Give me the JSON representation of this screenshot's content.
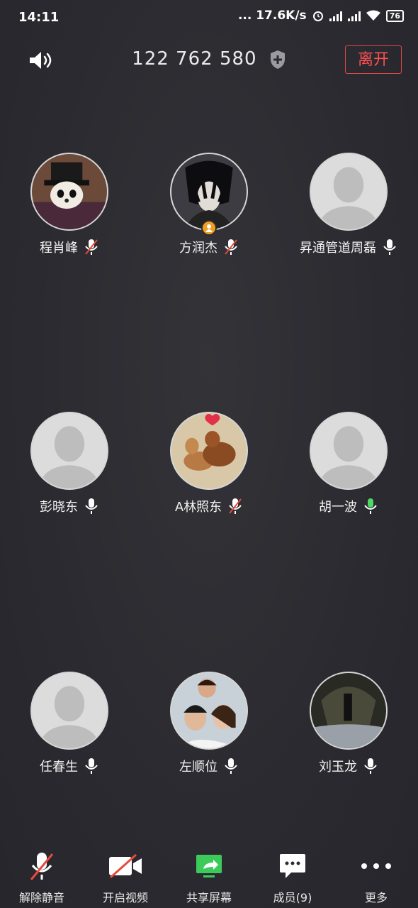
{
  "status_bar": {
    "time": "14:11",
    "net_speed": "... 17.6K/s",
    "battery": "76"
  },
  "header": {
    "meeting_id": "122 762 580",
    "leave_label": "离开"
  },
  "participants": [
    {
      "name": "程肖峰",
      "mic": "muted",
      "avatar": "panda-hat"
    },
    {
      "name": "方润杰",
      "mic": "muted",
      "avatar": "anime-dark",
      "host": true
    },
    {
      "name": "昇通管道周磊",
      "mic": "on",
      "avatar": "default"
    },
    {
      "name": "彭晓东",
      "mic": "on",
      "avatar": "default"
    },
    {
      "name": "A林照东",
      "mic": "muted",
      "avatar": "dogs"
    },
    {
      "name": "胡一波",
      "mic": "active",
      "avatar": "default"
    },
    {
      "name": "任春生",
      "mic": "on",
      "avatar": "default"
    },
    {
      "name": "左顺位",
      "mic": "on",
      "avatar": "family"
    },
    {
      "name": "刘玉龙",
      "mic": "on",
      "avatar": "dark-photo"
    }
  ],
  "toolbar": {
    "unmute": "解除静音",
    "start_video": "开启视频",
    "share_screen": "共享屏幕",
    "members": "成员(9)",
    "more": "更多"
  },
  "colors": {
    "background": "#2b2b31",
    "leave": "#ff5050",
    "share": "#3ccb5a",
    "mic_active": "#4cd964"
  }
}
